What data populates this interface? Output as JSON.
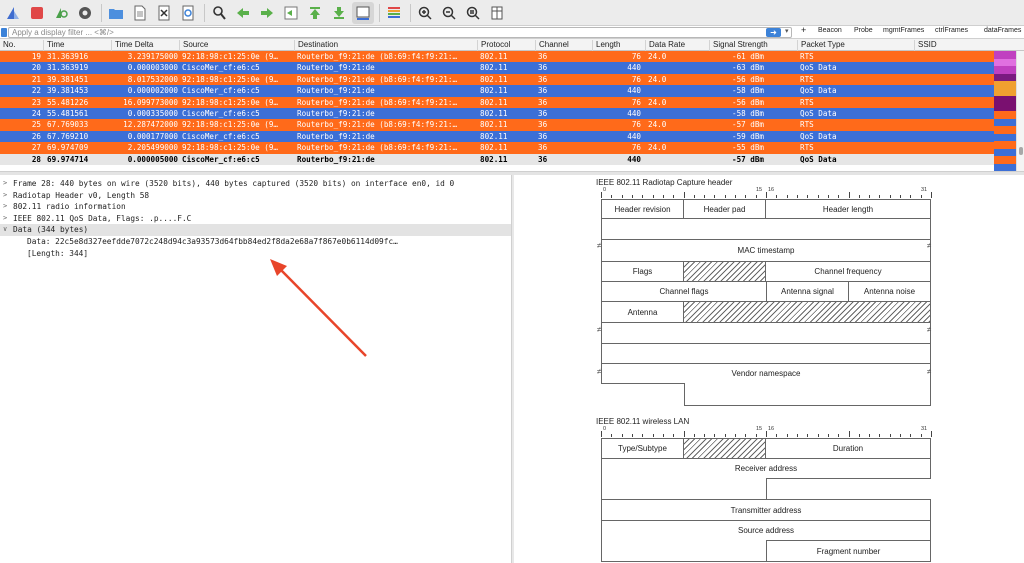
{
  "toolbar": {
    "icons": [
      "shark-fin-icon",
      "stop-icon",
      "restart-icon",
      "gear-icon",
      "folder-icon",
      "file-icon",
      "close-file-icon",
      "reload-icon",
      "find-icon",
      "arrow-left-icon",
      "arrow-right-icon",
      "goto-packet-icon",
      "first-packet-icon",
      "last-packet-icon",
      "autoscroll-icon",
      "colorize-icon",
      "zoom-in-icon",
      "zoom-out-icon",
      "zoom-reset-icon",
      "resize-columns-icon"
    ]
  },
  "filter": {
    "placeholder": "Apply a display filter ... <⌘/>",
    "plus": "+",
    "buttons": [
      "Beacon",
      "Probe",
      "mgmtFrames",
      "ctrlFrames",
      "dataFrames"
    ]
  },
  "columns": [
    "No.",
    "Time",
    "Time Delta",
    "Source",
    "Destination",
    "Protocol",
    "Channel",
    "Length",
    "Data Rate",
    "Signal Strength",
    "Packet Type",
    "SSID"
  ],
  "packets": [
    {
      "no": "19",
      "time": "31.363916",
      "delta": "3.239175000",
      "source": "92:18:98:c1:25:0e (9…",
      "dest": "Routerbo_f9:21:de (b8:69:f4:f9:21:…",
      "proto": "802.11",
      "chan": "36",
      "len": "76",
      "rate": "24.0",
      "signal": "-61 dBm",
      "type": "RTS",
      "style": "orange"
    },
    {
      "no": "20",
      "time": "31.363919",
      "delta": "0.000003000",
      "source": "CiscoMer_cf:e6:c5",
      "dest": "Routerbo_f9:21:de",
      "proto": "802.11",
      "chan": "36",
      "len": "440",
      "rate": "",
      "signal": "-63 dBm",
      "type": "QoS Data",
      "style": "blue"
    },
    {
      "no": "21",
      "time": "39.381451",
      "delta": "8.017532000",
      "source": "92:18:98:c1:25:0e (9…",
      "dest": "Routerbo_f9:21:de (b8:69:f4:f9:21:…",
      "proto": "802.11",
      "chan": "36",
      "len": "76",
      "rate": "24.0",
      "signal": "-56 dBm",
      "type": "RTS",
      "style": "orange"
    },
    {
      "no": "22",
      "time": "39.381453",
      "delta": "0.000002000",
      "source": "CiscoMer_cf:e6:c5",
      "dest": "Routerbo_f9:21:de",
      "proto": "802.11",
      "chan": "36",
      "len": "440",
      "rate": "",
      "signal": "-58 dBm",
      "type": "QoS Data",
      "style": "blue"
    },
    {
      "no": "23",
      "time": "55.481226",
      "delta": "16.099773000",
      "source": "92:18:98:c1:25:0e (9…",
      "dest": "Routerbo_f9:21:de (b8:69:f4:f9:21:…",
      "proto": "802.11",
      "chan": "36",
      "len": "76",
      "rate": "24.0",
      "signal": "-56 dBm",
      "type": "RTS",
      "style": "orange"
    },
    {
      "no": "24",
      "time": "55.481561",
      "delta": "0.000335000",
      "source": "CiscoMer_cf:e6:c5",
      "dest": "Routerbo_f9:21:de",
      "proto": "802.11",
      "chan": "36",
      "len": "440",
      "rate": "",
      "signal": "-58 dBm",
      "type": "QoS Data",
      "style": "blue"
    },
    {
      "no": "25",
      "time": "67.769033",
      "delta": "12.287472000",
      "source": "92:18:98:c1:25:0e (9…",
      "dest": "Routerbo_f9:21:de (b8:69:f4:f9:21:…",
      "proto": "802.11",
      "chan": "36",
      "len": "76",
      "rate": "24.0",
      "signal": "-57 dBm",
      "type": "RTS",
      "style": "orange"
    },
    {
      "no": "26",
      "time": "67.769210",
      "delta": "0.000177000",
      "source": "CiscoMer_cf:e6:c5",
      "dest": "Routerbo_f9:21:de",
      "proto": "802.11",
      "chan": "36",
      "len": "440",
      "rate": "",
      "signal": "-59 dBm",
      "type": "QoS Data",
      "style": "blue"
    },
    {
      "no": "27",
      "time": "69.974709",
      "delta": "2.205499000",
      "source": "92:18:98:c1:25:0e (9…",
      "dest": "Routerbo_f9:21:de (b8:69:f4:f9:21:…",
      "proto": "802.11",
      "chan": "36",
      "len": "76",
      "rate": "24.0",
      "signal": "-55 dBm",
      "type": "RTS",
      "style": "orange"
    },
    {
      "no": "28",
      "time": "69.974714",
      "delta": "0.000005000",
      "source": "CiscoMer_cf:e6:c5",
      "dest": "Routerbo_f9:21:de",
      "proto": "802.11",
      "chan": "36",
      "len": "440",
      "rate": "",
      "signal": "-57 dBm",
      "type": "QoS Data",
      "style": "selected"
    }
  ],
  "row_colors": {
    "orange": "#ff6a1a",
    "blue": "#3c6fd6",
    "selected": "#e6e6e6",
    "orange_text": "#ffffff",
    "blue_text": "#ffffff",
    "selected_text": "#000000"
  },
  "minimap_colors": [
    "#c040c0",
    "#e070e0",
    "#c040c0",
    "#7a1a80",
    "#f0a030",
    "#f0a030",
    "#7a1070",
    "#7a1070",
    "#ff6a1a",
    "#3c6fd6",
    "#ff6a1a",
    "#3c6fd6",
    "#ff6a1a",
    "#3c6fd6",
    "#ff6a1a",
    "#3c6fd6"
  ],
  "details": [
    {
      "text": "Frame 28: 440 bytes on wire (3520 bits), 440 bytes captured (3520 bits) on interface en0, id 0",
      "chev": ">",
      "indent": 0
    },
    {
      "text": "Radiotap Header v0, Length 58",
      "chev": ">",
      "indent": 0
    },
    {
      "text": "802.11 radio information",
      "chev": ">",
      "indent": 0
    },
    {
      "text": "IEEE 802.11 QoS Data, Flags: .p....F.C",
      "chev": ">",
      "indent": 0
    },
    {
      "text": "Data (344 bytes)",
      "chev": "∨",
      "indent": 0,
      "sel": true
    },
    {
      "text": "Data: 22c5e8d327eefdde7072c248d94c3a93573d64fbb84ed2f8da2e68a7f867e0b6114d09fc…",
      "chev": "",
      "indent": 1
    },
    {
      "text": "[Length: 344]",
      "chev": "",
      "indent": 1
    }
  ],
  "annotation_arrow": {
    "color": "#e8452a"
  },
  "radiotap": {
    "title": "IEEE 802.11 Radiotap Capture header",
    "ruler": [
      "0",
      "15",
      "16",
      "31"
    ],
    "fields": {
      "header_revision": "Header revision",
      "header_pad": "Header pad",
      "header_length": "Header length",
      "mac_timestamp": "MAC timestamp",
      "flags": "Flags",
      "channel_frequency": "Channel frequency",
      "channel_flags": "Channel flags",
      "antenna_signal": "Antenna signal",
      "antenna_noise": "Antenna noise",
      "antenna": "Antenna",
      "vendor_namespace": "Vendor namespace"
    }
  },
  "wlan": {
    "title": "IEEE 802.11 wireless LAN",
    "ruler": [
      "0",
      "15",
      "16",
      "31"
    ],
    "fields": {
      "type_subtype": "Type/Subtype",
      "duration": "Duration",
      "receiver_address": "Receiver address",
      "transmitter_address": "Transmitter address",
      "source_address": "Source address",
      "fragment_number": "Fragment number"
    }
  }
}
